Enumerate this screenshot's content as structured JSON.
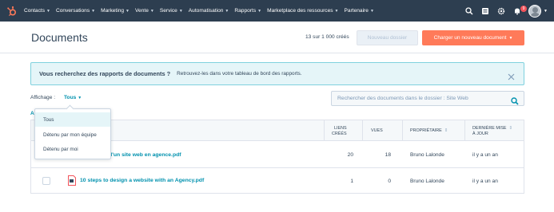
{
  "nav": {
    "logo": "hubspot-logo",
    "items": [
      {
        "label": "Contacts"
      },
      {
        "label": "Conversations"
      },
      {
        "label": "Marketing"
      },
      {
        "label": "Vente"
      },
      {
        "label": "Service"
      },
      {
        "label": "Automatisation"
      },
      {
        "label": "Rapports"
      },
      {
        "label": "Marketplace des ressources"
      },
      {
        "label": "Partenaire"
      }
    ],
    "notification_count": "9",
    "icons": [
      "search-icon",
      "marketplace-icon",
      "settings-icon",
      "notifications-icon",
      "avatar"
    ]
  },
  "header": {
    "title": "Documents",
    "count_text": "13 sur 1 000 créés",
    "new_folder_label": "Nouveau dossier",
    "upload_label": "Charger un nouveau document"
  },
  "banner": {
    "title": "Vous recherchez des rapports de documents ?",
    "text": "Retrouvez-les dans votre tableau de bord des rapports."
  },
  "filters": {
    "view_label": "Affichage :",
    "view_value": "Tous",
    "a_stub": "A",
    "search_placeholder": "Rechercher des documents dans le dossier : Site Web"
  },
  "dropdown": {
    "options": [
      {
        "label": "Tous",
        "selected": true
      },
      {
        "label": "Détenu par mon équipe",
        "selected": false
      },
      {
        "label": "Détenu par moi",
        "selected": false
      }
    ]
  },
  "table": {
    "columns": {
      "links_line1": "LIENS",
      "links_line2": "CRÉÉS",
      "views": "VUES",
      "owner": "PROPRIÉTAIRE",
      "updated_line1": "DERNIÈRE MISE",
      "updated_line2": "À JOUR"
    },
    "rows": [
      {
        "name": "conception d'un site web en agence.pdf",
        "links": "20",
        "views": "18",
        "owner": "Bruno Lalonde",
        "updated": "il y a un an"
      },
      {
        "name": "10 steps to design a website with an Agency.pdf",
        "links": "1",
        "views": "0",
        "owner": "Bruno Lalonde",
        "updated": "il y a un an"
      }
    ]
  },
  "colors": {
    "nav_bg": "#2d3e50",
    "accent": "#ff7a59",
    "link": "#0091ae",
    "banner_bg": "#e5f5f8",
    "banner_border": "#7fd1de"
  }
}
